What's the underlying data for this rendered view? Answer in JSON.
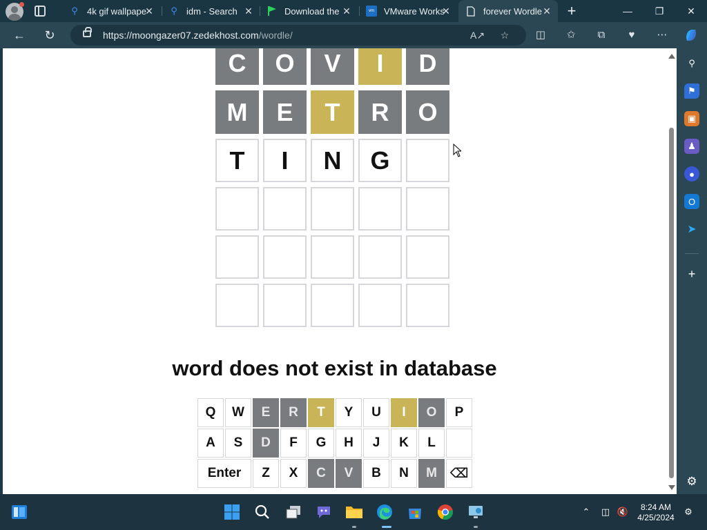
{
  "browser": {
    "tabs": [
      {
        "title": "4k gif wallpape",
        "icon": "search-icon"
      },
      {
        "title": "idm - Search",
        "icon": "search-icon"
      },
      {
        "title": "Download the",
        "icon": "flag-icon"
      },
      {
        "title": "VMware Works",
        "icon": "vmware-icon"
      },
      {
        "title": "forever Wordle",
        "icon": "page-icon",
        "active": true
      }
    ],
    "url_host": "https://moongazer07.zedekhost.com",
    "url_path": "/wordle/"
  },
  "game": {
    "rows": [
      [
        {
          "l": "C",
          "s": "gray"
        },
        {
          "l": "O",
          "s": "gray"
        },
        {
          "l": "V",
          "s": "gray"
        },
        {
          "l": "I",
          "s": "yellow"
        },
        {
          "l": "D",
          "s": "gray"
        }
      ],
      [
        {
          "l": "M",
          "s": "gray"
        },
        {
          "l": "E",
          "s": "gray"
        },
        {
          "l": "T",
          "s": "yellow"
        },
        {
          "l": "R",
          "s": "gray"
        },
        {
          "l": "O",
          "s": "gray"
        }
      ],
      [
        {
          "l": "T",
          "s": "empty"
        },
        {
          "l": "I",
          "s": "empty"
        },
        {
          "l": "N",
          "s": "empty"
        },
        {
          "l": "G",
          "s": "empty"
        },
        {
          "l": "",
          "s": "empty"
        }
      ],
      [
        {
          "l": "",
          "s": "empty"
        },
        {
          "l": "",
          "s": "empty"
        },
        {
          "l": "",
          "s": "empty"
        },
        {
          "l": "",
          "s": "empty"
        },
        {
          "l": "",
          "s": "empty"
        }
      ],
      [
        {
          "l": "",
          "s": "empty"
        },
        {
          "l": "",
          "s": "empty"
        },
        {
          "l": "",
          "s": "empty"
        },
        {
          "l": "",
          "s": "empty"
        },
        {
          "l": "",
          "s": "empty"
        }
      ],
      [
        {
          "l": "",
          "s": "empty"
        },
        {
          "l": "",
          "s": "empty"
        },
        {
          "l": "",
          "s": "empty"
        },
        {
          "l": "",
          "s": "empty"
        },
        {
          "l": "",
          "s": "empty"
        }
      ]
    ],
    "message": "word does not exist in database",
    "keyboard": [
      [
        {
          "k": "Q",
          "s": "none"
        },
        {
          "k": "W",
          "s": "none"
        },
        {
          "k": "E",
          "s": "gray"
        },
        {
          "k": "R",
          "s": "gray"
        },
        {
          "k": "T",
          "s": "yellow"
        },
        {
          "k": "Y",
          "s": "none"
        },
        {
          "k": "U",
          "s": "none"
        },
        {
          "k": "I",
          "s": "yellow"
        },
        {
          "k": "O",
          "s": "gray"
        },
        {
          "k": "P",
          "s": "none"
        }
      ],
      [
        {
          "k": "A",
          "s": "none"
        },
        {
          "k": "S",
          "s": "none"
        },
        {
          "k": "D",
          "s": "gray"
        },
        {
          "k": "F",
          "s": "none"
        },
        {
          "k": "G",
          "s": "none"
        },
        {
          "k": "H",
          "s": "none"
        },
        {
          "k": "J",
          "s": "none"
        },
        {
          "k": "K",
          "s": "none"
        },
        {
          "k": "L",
          "s": "none"
        },
        {
          "k": "",
          "s": "none"
        }
      ],
      [
        {
          "k": "Enter",
          "s": "none"
        },
        {
          "k": "Z",
          "s": "none"
        },
        {
          "k": "X",
          "s": "none"
        },
        {
          "k": "C",
          "s": "gray"
        },
        {
          "k": "V",
          "s": "gray"
        },
        {
          "k": "B",
          "s": "none"
        },
        {
          "k": "N",
          "s": "none"
        },
        {
          "k": "M",
          "s": "gray"
        },
        {
          "k": "⌫",
          "s": "none"
        }
      ]
    ]
  },
  "taskbar": {
    "time": "8:24 AM",
    "date": "4/25/2024"
  },
  "colors": {
    "absent": "#787c7e",
    "present": "#c9b458",
    "browser_chrome": "#2a4753"
  }
}
